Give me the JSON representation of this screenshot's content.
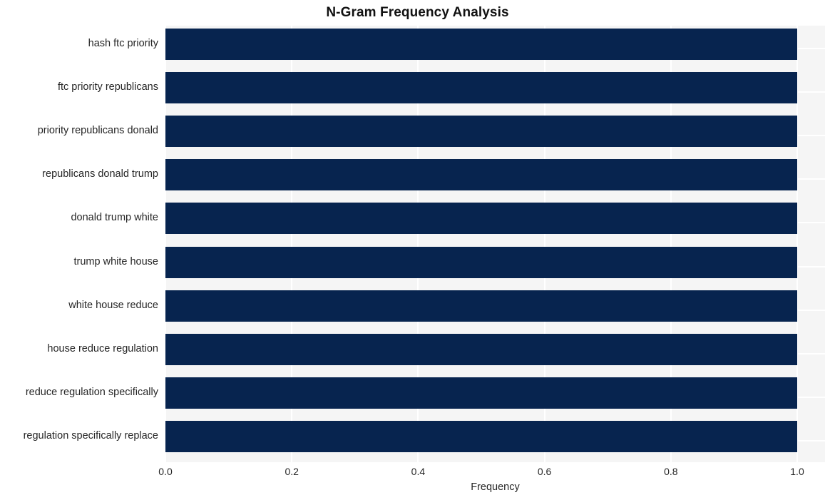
{
  "chart_data": {
    "type": "bar",
    "orientation": "horizontal",
    "title": "N-Gram Frequency Analysis",
    "xlabel": "Frequency",
    "ylabel": "",
    "xlim": [
      0.0,
      1.0
    ],
    "xticks": [
      "0.0",
      "0.2",
      "0.4",
      "0.6",
      "0.8",
      "1.0"
    ],
    "xtick_values": [
      0.0,
      0.2,
      0.4,
      0.6,
      0.8,
      1.0
    ],
    "grid": true,
    "legend": "none",
    "bar_color": "#07244f",
    "plot_background": "#f5f5f5",
    "gridline_color": "#ffffff",
    "figure_background": "#ffffff",
    "categories": [
      "hash ftc priority",
      "ftc priority republicans",
      "priority republicans donald",
      "republicans donald trump",
      "donald trump white",
      "trump white house",
      "white house reduce",
      "house reduce regulation",
      "reduce regulation specifically",
      "regulation specifically replace"
    ],
    "values": [
      1.0,
      1.0,
      1.0,
      1.0,
      1.0,
      1.0,
      1.0,
      1.0,
      1.0,
      1.0
    ]
  }
}
